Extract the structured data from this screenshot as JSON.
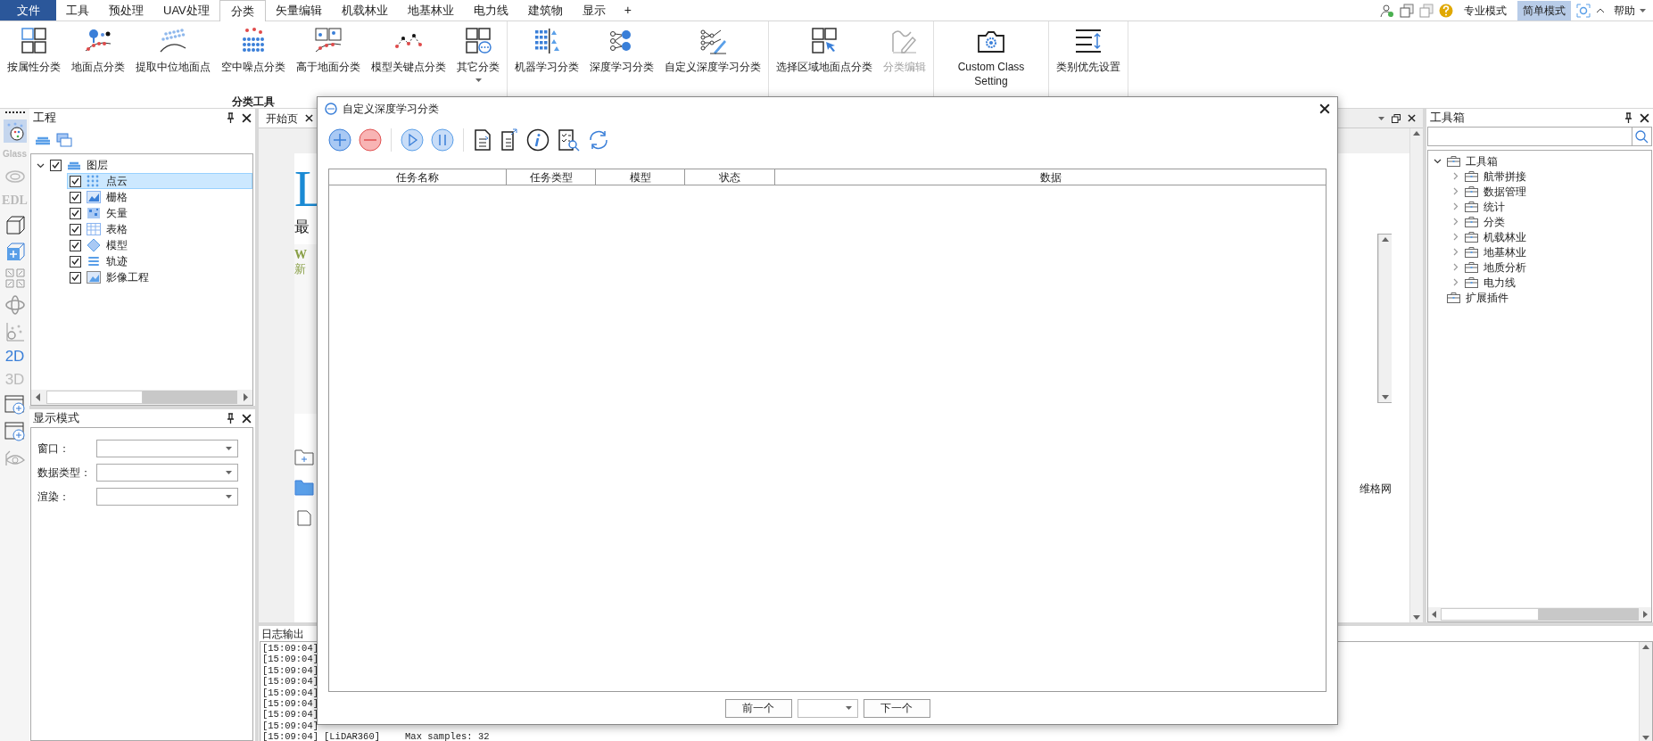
{
  "menu": {
    "tabs": [
      {
        "label": "文件",
        "kind": "file",
        "selected": false
      },
      {
        "label": "工具",
        "kind": "tab",
        "selected": false
      },
      {
        "label": "预处理",
        "kind": "tab",
        "selected": false
      },
      {
        "label": "UAV处理",
        "kind": "tab",
        "selected": false
      },
      {
        "label": "分类",
        "kind": "tab",
        "selected": true
      },
      {
        "label": "矢量编辑",
        "kind": "tab",
        "selected": false
      },
      {
        "label": "机载林业",
        "kind": "tab",
        "selected": false
      },
      {
        "label": "地基林业",
        "kind": "tab",
        "selected": false
      },
      {
        "label": "电力线",
        "kind": "tab",
        "selected": false
      },
      {
        "label": "建筑物",
        "kind": "tab",
        "selected": false
      },
      {
        "label": "显示",
        "kind": "tab",
        "selected": false
      },
      {
        "label": "+",
        "kind": "add",
        "selected": false
      }
    ]
  },
  "header_right": {
    "modes": [
      {
        "label": "专业模式",
        "selected": false
      },
      {
        "label": "简单模式",
        "selected": true
      }
    ],
    "help": "帮助"
  },
  "ribbon": {
    "groups": [
      {
        "label": "分类工具",
        "buttons": [
          {
            "label": "按属性分类",
            "disabled": false
          },
          {
            "label": "地面点分类",
            "disabled": false
          },
          {
            "label": "提取中位地面点",
            "disabled": false
          },
          {
            "label": "空中噪点分类",
            "disabled": false
          },
          {
            "label": "高于地面分类",
            "disabled": false
          },
          {
            "label": "模型关键点分类",
            "disabled": false
          },
          {
            "label": "其它分类",
            "disabled": false,
            "dropdown": true
          }
        ]
      },
      {
        "buttons": [
          {
            "label": "机器学习分类",
            "disabled": false
          },
          {
            "label": "深度学习分类",
            "disabled": false
          },
          {
            "label": "自定义深度学习分类",
            "disabled": false
          }
        ]
      },
      {
        "buttons": [
          {
            "label": "选择区域地面点分类",
            "disabled": false
          },
          {
            "label": "分类编辑",
            "disabled": true
          }
        ]
      },
      {
        "buttons": [
          {
            "label": "Custom Class Setting",
            "disabled": false
          }
        ]
      },
      {
        "buttons": [
          {
            "label": "类别优先设置",
            "disabled": false
          }
        ]
      }
    ]
  },
  "left_toolbar": [
    {
      "label": "Glass",
      "selected": false
    },
    {
      "label": "EDL",
      "selected": false
    },
    {
      "label": "2D",
      "selected": true
    },
    {
      "label": "3D",
      "selected": false
    }
  ],
  "project_panel": {
    "title": "工程",
    "tree": [
      {
        "label": "图层",
        "checked": true,
        "expanded": true,
        "selected": false,
        "children": [
          {
            "label": "点云",
            "checked": true,
            "selected": true
          },
          {
            "label": "栅格",
            "checked": true,
            "selected": false
          },
          {
            "label": "矢量",
            "checked": true,
            "selected": false
          },
          {
            "label": "表格",
            "checked": true,
            "selected": false
          },
          {
            "label": "模型",
            "checked": true,
            "selected": false
          },
          {
            "label": "轨迹",
            "checked": true,
            "selected": false
          },
          {
            "label": "影像工程",
            "checked": true,
            "selected": false
          }
        ]
      }
    ]
  },
  "display_panel": {
    "title": "显示模式",
    "fields": [
      {
        "label": "窗口："
      },
      {
        "label": "数据类型："
      },
      {
        "label": "渲染："
      }
    ]
  },
  "document": {
    "tabs": [
      {
        "label": "开始页",
        "selected": true
      }
    ],
    "start_page": {
      "logo_fragment": "L",
      "heading_fragment": "最",
      "news_title_fragment": "W",
      "news_text_fragment": "新",
      "link_fragment": "维格网"
    }
  },
  "dialog": {
    "title": "自定义深度学习分类",
    "table": {
      "columns": [
        "任务名称",
        "任务类型",
        "模型",
        "状态",
        "数据"
      ]
    },
    "pagination": {
      "previous": "前一个",
      "next": "下一个"
    }
  },
  "log_panel": {
    "title": "日志输出",
    "lines": [
      {
        "time": "[15:09:04]"
      },
      {
        "time": "[15:09:04]"
      },
      {
        "time": "[15:09:04]"
      },
      {
        "time": "[15:09:04]"
      },
      {
        "time": "[15:09:04]"
      },
      {
        "time": "[15:09:04]"
      },
      {
        "time": "[15:09:04]"
      },
      {
        "time": "[15:09:04]"
      },
      {
        "time": "[15:09:04]",
        "source": "[LiDAR360]",
        "message": "Max samples: 32"
      }
    ]
  },
  "toolbox": {
    "title": "工具箱",
    "tree": [
      {
        "label": "工具箱",
        "expanded": true,
        "children": [
          {
            "label": "航带拼接",
            "expanded": false
          },
          {
            "label": "数据管理",
            "expanded": false
          },
          {
            "label": "统计",
            "expanded": false
          },
          {
            "label": "分类",
            "expanded": false
          },
          {
            "label": "机载林业",
            "expanded": false
          },
          {
            "label": "地基林业",
            "expanded": false
          },
          {
            "label": "地质分析",
            "expanded": false
          },
          {
            "label": "电力线",
            "expanded": false
          }
        ]
      },
      {
        "label": "扩展插件"
      }
    ]
  }
}
